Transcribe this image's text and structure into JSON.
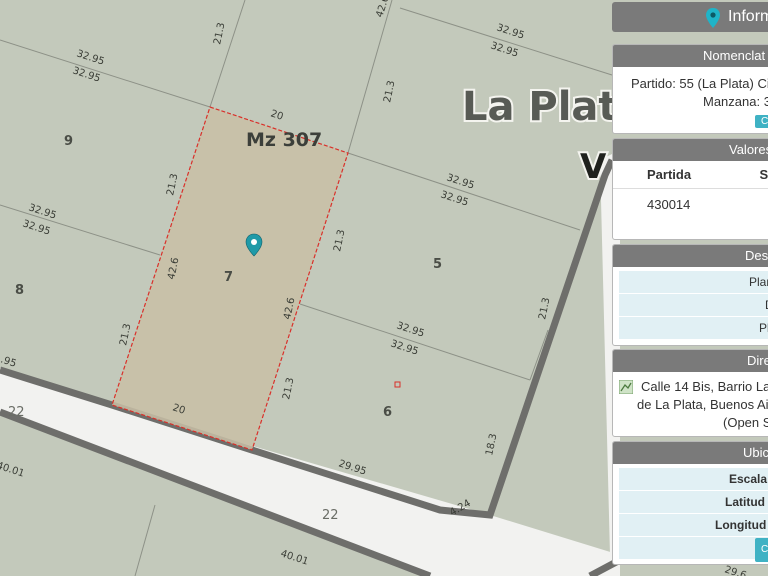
{
  "map": {
    "city_label_1": "La Plat",
    "city_label_2": "V",
    "block_label": "Mz 307",
    "lots": [
      {
        "id": "lot-9",
        "label": "9"
      },
      {
        "id": "lot-8",
        "label": "8"
      },
      {
        "id": "lot-7",
        "label": "7"
      },
      {
        "id": "lot-6",
        "label": "6"
      },
      {
        "id": "lot-5",
        "label": "5"
      }
    ],
    "dimensions": [
      "42.6",
      "21.3",
      "32.95",
      "32.95",
      "32.95",
      "32.95",
      "21.3",
      "32.95",
      "32.95",
      "21.3",
      "20",
      "32.95",
      "32.95",
      "21.3",
      "42.6",
      "21.3",
      "42.6",
      "21.3",
      "32.95",
      "32.95",
      "21.3",
      "20",
      "29.95",
      "18.3",
      "4.24",
      "40.01",
      "40.01",
      "29.6",
      ".95"
    ],
    "streets": [
      "22",
      "22"
    ],
    "colors": {
      "map_bg": "#c3c9bb",
      "selected_lot": "#c9bfa6",
      "selected_border": "#d9302a",
      "road": "#f2f2f0",
      "road_edge": "#6e6e6b",
      "pin": "#1f9aa8"
    }
  },
  "panel": {
    "title": "Inform",
    "nomenclatura": {
      "heading": "Nomenclat",
      "line1": "Partido: 55 (La Plata) Cir",
      "line2": "Manzana: 3",
      "button": "C"
    },
    "valores": {
      "heading": "Valores",
      "col1": "Partida",
      "col2": "S",
      "partida_value": "430014"
    },
    "descripcion": {
      "heading": "Des",
      "rows": [
        "Plan",
        "D",
        "Pl"
      ]
    },
    "direccion": {
      "heading": "Dire",
      "line1": "Calle 14 Bis, Barrio La",
      "line2": "de La Plata, Buenos Air",
      "line3": "(Open S"
    },
    "ubicacion": {
      "heading": "Ubic",
      "rows": [
        "Escala",
        "Latitud",
        "Longitud"
      ],
      "button": "C"
    }
  }
}
